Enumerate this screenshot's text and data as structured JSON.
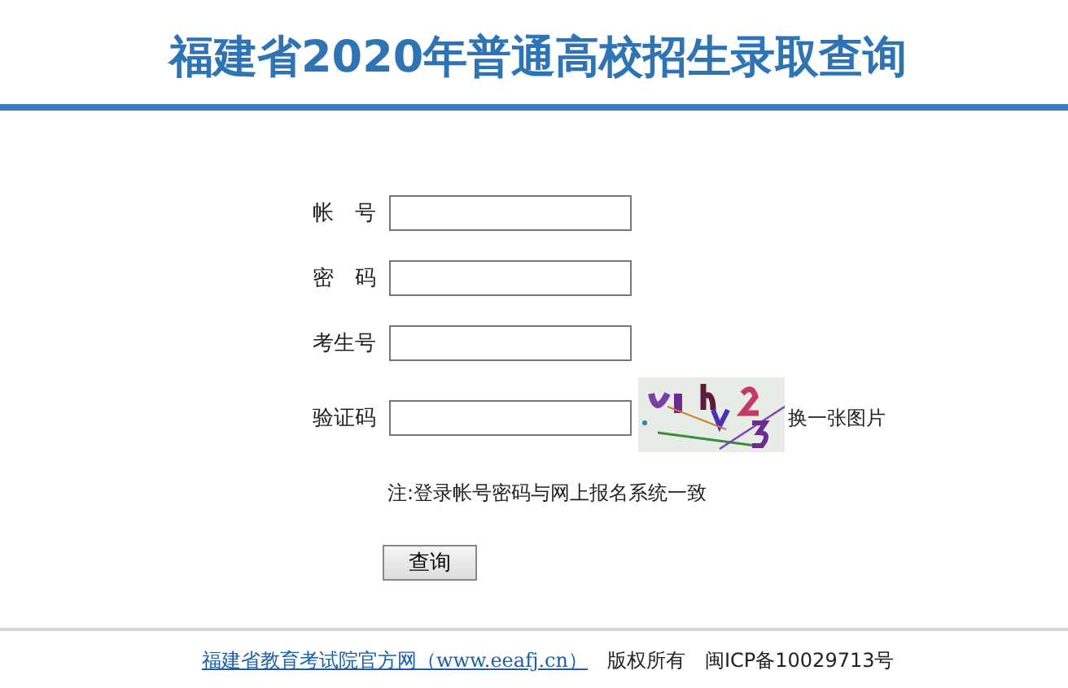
{
  "header": {
    "title": "福建省2020年普通高校招生录取查询"
  },
  "form": {
    "fields": [
      {
        "label": "帐　号",
        "kind": "text"
      },
      {
        "label": "密　码",
        "kind": "password"
      },
      {
        "label": "考生号",
        "kind": "text"
      },
      {
        "label": "验证码",
        "kind": "captcha",
        "refresh_link": "换一张图片"
      }
    ],
    "note": "注:登录帐号密码与网上报名系统一致",
    "submit": "查询"
  },
  "footer": {
    "link": "福建省教育考试院官方网（www.eeafj.cn）",
    "copyright": "版权所有",
    "icp": "闽ICP备10029713号"
  }
}
